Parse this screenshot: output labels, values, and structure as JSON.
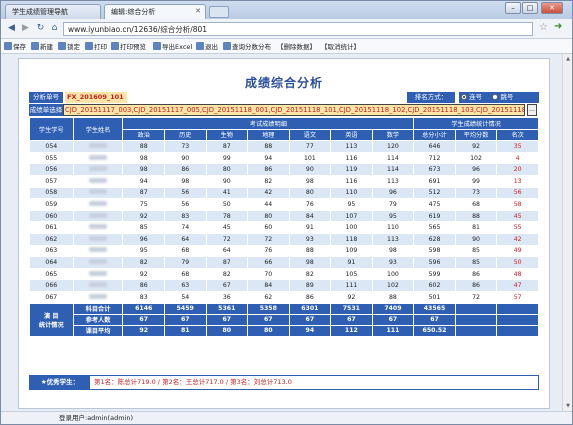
{
  "browser": {
    "tabs": [
      {
        "label": "学生成绩管理导航"
      },
      {
        "label": "编辑:综合分析"
      }
    ],
    "address": "www.iyunbiao.cn/12636/综合分析/801",
    "toolbar": [
      "保存",
      "新建",
      "锁定",
      "打印",
      "打印预览",
      "导出Excel",
      "退出",
      "查询分数分布",
      "【删除数据】",
      "【取消统计】"
    ]
  },
  "page": {
    "title": "成绩综合分析",
    "analysis_no_label": "分析单号",
    "analysis_no": "FX_201609_101",
    "rank_label": "排名方式：",
    "rank_options": [
      {
        "label": "连号",
        "selected": true
      },
      {
        "label": "跳号",
        "selected": false
      }
    ],
    "exam_select_label": "成绩单选择",
    "exam_select_value": "CJD_20151117_003,CJD_20151117_005,CJD_20151118_001,CJD_20151118_101,CJD_20151118_102,CJD_20151118_103,CJD_20151118_104",
    "dots": "...",
    "headers": {
      "student_no": "学生学号",
      "student_name": "学生姓名",
      "exam_group": "考试成绩明细",
      "stat_group": "学生成绩统计情况",
      "subjects": [
        "政治",
        "历史",
        "生物",
        "地理",
        "语文",
        "英语",
        "数学"
      ],
      "stats": [
        "总分小计",
        "平均分数",
        "名次"
      ]
    },
    "rows": [
      {
        "no": "054",
        "scores": [
          88,
          73,
          87,
          88,
          77,
          113,
          120
        ],
        "total": 646,
        "avg": 92,
        "rank": 35
      },
      {
        "no": "055",
        "scores": [
          98,
          90,
          99,
          94,
          101,
          116,
          114
        ],
        "total": 712,
        "avg": 102,
        "rank": 4
      },
      {
        "no": "056",
        "scores": [
          98,
          86,
          80,
          86,
          90,
          119,
          114
        ],
        "total": 673,
        "avg": 96,
        "rank": 20
      },
      {
        "no": "057",
        "scores": [
          94,
          98,
          90,
          82,
          98,
          116,
          113
        ],
        "total": 691,
        "avg": 99,
        "rank": 13
      },
      {
        "no": "058",
        "scores": [
          87,
          56,
          41,
          42,
          80,
          110,
          96
        ],
        "total": 512,
        "avg": 73,
        "rank": 56
      },
      {
        "no": "059",
        "scores": [
          75,
          56,
          50,
          44,
          76,
          95,
          79
        ],
        "total": 475,
        "avg": 68,
        "rank": 58
      },
      {
        "no": "060",
        "scores": [
          92,
          83,
          78,
          80,
          84,
          107,
          95
        ],
        "total": 619,
        "avg": 88,
        "rank": 45
      },
      {
        "no": "061",
        "scores": [
          85,
          74,
          45,
          60,
          91,
          100,
          110
        ],
        "total": 565,
        "avg": 81,
        "rank": 55
      },
      {
        "no": "062",
        "scores": [
          96,
          64,
          72,
          72,
          93,
          118,
          113
        ],
        "total": 628,
        "avg": 90,
        "rank": 42
      },
      {
        "no": "063",
        "scores": [
          95,
          68,
          64,
          76,
          88,
          109,
          98
        ],
        "total": 598,
        "avg": 85,
        "rank": 49
      },
      {
        "no": "064",
        "scores": [
          82,
          79,
          87,
          66,
          98,
          91,
          93
        ],
        "total": 596,
        "avg": 85,
        "rank": 50
      },
      {
        "no": "065",
        "scores": [
          92,
          68,
          82,
          70,
          82,
          105,
          100
        ],
        "total": 599,
        "avg": 86,
        "rank": 48
      },
      {
        "no": "066",
        "scores": [
          86,
          63,
          67,
          84,
          89,
          111,
          102
        ],
        "total": 602,
        "avg": 86,
        "rank": 47
      },
      {
        "no": "067",
        "scores": [
          83,
          54,
          36,
          62,
          86,
          92,
          88
        ],
        "total": 501,
        "avg": 72,
        "rank": 57
      }
    ],
    "summary_label": "演 目\n统计情况",
    "summary": [
      {
        "label": "科目合计",
        "values": [
          "6146",
          "5459",
          "5361",
          "5358",
          "6301",
          "7531",
          "7409",
          "43565",
          "",
          ""
        ]
      },
      {
        "label": "参考人数",
        "values": [
          "67",
          "67",
          "67",
          "67",
          "67",
          "67",
          "67",
          "67",
          "",
          ""
        ]
      },
      {
        "label": "课目平均",
        "values": [
          "92",
          "81",
          "80",
          "80",
          "94",
          "112",
          "111",
          "650.52",
          "",
          ""
        ]
      }
    ],
    "excellent_label": "★优秀学生：",
    "excellent_text": "第1名：陈总计719.0 / 第2名：王总计717.0 / 第3名：刘总计713.0"
  },
  "status": "登录用户:admin(admin)"
}
